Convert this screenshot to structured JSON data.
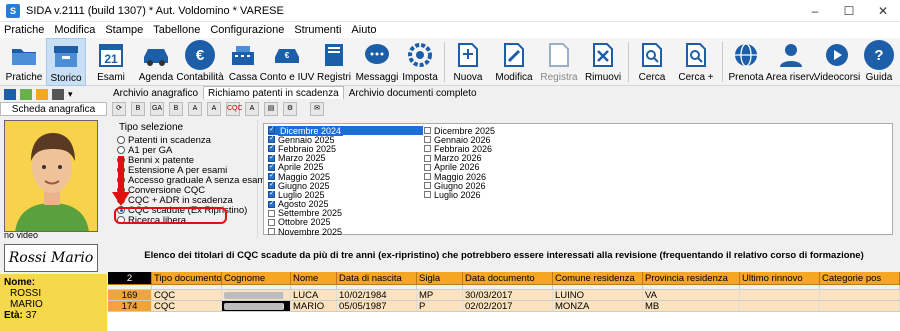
{
  "window": {
    "title": "SIDA v.2111 (build 1307) * Aut. Voldomino * VARESE",
    "min": "–",
    "max": "☐",
    "close": "✕"
  },
  "menu": [
    "Pratiche",
    "Modifica",
    "Stampe",
    "Tabellone",
    "Configurazione",
    "Strumenti",
    "Aiuto"
  ],
  "toolbar": [
    {
      "label": "Pratiche",
      "icon": "folder-icon"
    },
    {
      "label": "Storico",
      "icon": "archive-box-icon",
      "selected": true
    },
    {
      "label": "Esami",
      "icon": "calendar-21-icon",
      "glyph": "21"
    },
    {
      "label": "Agenda",
      "icon": "car-icon"
    },
    {
      "label": "Contabilità",
      "icon": "euro-icon",
      "glyph": "€"
    },
    {
      "label": "Cassa",
      "icon": "cash-register-icon"
    },
    {
      "label": "Conto e IUV",
      "icon": "car-payment-icon"
    },
    {
      "label": "Registri",
      "icon": "register-book-icon"
    },
    {
      "label": "Messaggi",
      "icon": "chat-bubble-icon"
    },
    {
      "label": "Imposta",
      "icon": "settings-cog-icon"
    },
    {
      "label": "Nuova",
      "icon": "new-document-icon"
    },
    {
      "label": "Modifica",
      "icon": "edit-document-icon"
    },
    {
      "label": "Registra",
      "icon": "save-document-icon",
      "disabled": true
    },
    {
      "label": "Rimuovi",
      "icon": "delete-document-icon"
    },
    {
      "label": "Cerca",
      "icon": "search-icon"
    },
    {
      "label": "Cerca +",
      "icon": "search-plus-icon"
    },
    {
      "label": "Prenota",
      "icon": "globe-icon"
    },
    {
      "label": "Area riserv.",
      "icon": "user-area-icon"
    },
    {
      "label": "Videocorsi",
      "icon": "video-course-icon"
    },
    {
      "label": "Guida",
      "icon": "help-icon",
      "glyph": "?"
    }
  ],
  "left_panel": {
    "header": "Scheda anagrafica",
    "no_video": "no video",
    "signature": "Rossi Mario",
    "name_label": "Nome:",
    "surname": "ROSSI",
    "first_name": "MARIO",
    "age_label": "Età:",
    "age": "37"
  },
  "tabs": [
    "Archivio anagrafico",
    "Richiamo patenti in scadenza",
    "Archivio documenti completo"
  ],
  "selection": {
    "title": "Tipo selezione",
    "options": [
      "Patenti in scadenza",
      "A1 per GA",
      "Benni x patente",
      "Estensione A per esami",
      "Accesso graduale A senza esame",
      "Conversione CQC",
      "CQC + ADR in scadenza",
      "CQC scadute (Ex Ripristino)",
      "Ricerca libera"
    ],
    "selected_index": 7
  },
  "months_col1": [
    {
      "label": "Dicembre 2024",
      "checked": true,
      "selected": true
    },
    {
      "label": "Gennaio 2025",
      "checked": true
    },
    {
      "label": "Febbraio 2025",
      "checked": true
    },
    {
      "label": "Marzo 2025",
      "checked": true
    },
    {
      "label": "Aprile 2025",
      "checked": true
    },
    {
      "label": "Maggio 2025",
      "checked": true
    },
    {
      "label": "Giugno 2025",
      "checked": true
    },
    {
      "label": "Luglio 2025",
      "checked": true
    },
    {
      "label": "Agosto 2025",
      "checked": true
    },
    {
      "label": "Settembre 2025",
      "checked": false
    },
    {
      "label": "Ottobre 2025",
      "checked": false
    },
    {
      "label": "Novembre 2025",
      "checked": false
    }
  ],
  "months_col2": [
    {
      "label": "Dicembre 2025",
      "checked": false
    },
    {
      "label": "Gennaio 2026",
      "checked": false
    },
    {
      "label": "Febbraio 2026",
      "checked": false
    },
    {
      "label": "Marzo 2026",
      "checked": false
    },
    {
      "label": "Aprile 2026",
      "checked": false
    },
    {
      "label": "Maggio 2026",
      "checked": false
    },
    {
      "label": "Giugno 2026",
      "checked": false
    },
    {
      "label": "Luglio 2026",
      "checked": false
    }
  ],
  "description": "Elenco dei titolari di CQC scadute da più di tre anni (ex-ripristino) che potrebbero essere interessati alla revisione (frequentando il relativo corso di formazione)",
  "grid": {
    "count": "2",
    "columns": [
      "Tipo documento",
      "Cognome",
      "Nome",
      "Data di nascita",
      "Sigla",
      "Data documento",
      "Comune residenza",
      "Provincia residenza",
      "Ultimo rinnovo",
      "Categorie pos"
    ],
    "rows": [
      {
        "id": "169",
        "tipo": "CQC",
        "cognome": "",
        "nome": "LUCA",
        "nascita": "10/02/1984",
        "sigla": "MP",
        "data_doc": "30/03/2017",
        "comune": "LUINO",
        "provincia": "VA",
        "rinnovo": "",
        "categorie": ""
      },
      {
        "id": "174",
        "tipo": "CQC",
        "cognome": "",
        "nome": "MARIO",
        "nascita": "05/05/1987",
        "sigla": "P",
        "data_doc": "02/02/2017",
        "comune": "MONZA",
        "provincia": "MB",
        "rinnovo": "",
        "categorie": ""
      }
    ]
  },
  "colors": {
    "accent": "#1c5fa8",
    "grid_header": "#f5a623",
    "person_bg": "#f6d84c",
    "highlight": "#e01010"
  }
}
